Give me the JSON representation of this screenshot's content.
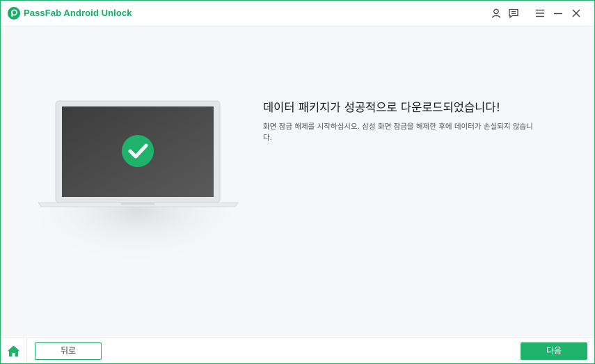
{
  "app": {
    "title": "PassFab Android Unlock"
  },
  "titlebar": {
    "icons": [
      "user-icon",
      "feedback-icon",
      "menu-icon",
      "minimize-icon",
      "close-icon"
    ]
  },
  "main": {
    "headline": "데이터 패키지가 성공적으로 다운로드되었습니다!",
    "description": "화면 잠금 해제를 시작하십시오. 삼성 화면 잠금을 해제한 후에 데이터가 손실되지 않습니다.",
    "status_icon": "check-circle-icon"
  },
  "footer": {
    "home_icon": "home-icon",
    "back_label": "뒤로",
    "next_label": "다음"
  },
  "colors": {
    "accent": "#1fb26b",
    "background": "#f6f7f9",
    "title_green": "#13b065"
  }
}
